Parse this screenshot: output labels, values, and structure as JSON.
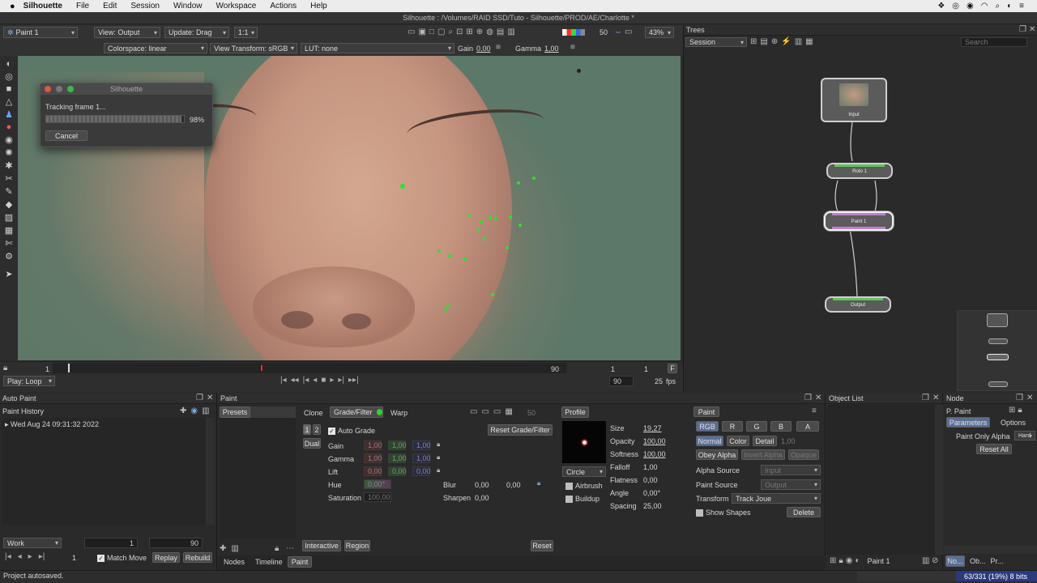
{
  "menubar": {
    "app": "Silhouette",
    "items": [
      "File",
      "Edit",
      "Session",
      "Window",
      "Workspace",
      "Actions",
      "Help"
    ],
    "clock_tray": "",
    "window_title": "Silhouette : /Volumes/RAID SSD/Tuto - Silhouette/PROD/AE/Charlotte *"
  },
  "viewer_toolbar": {
    "node_select": "Paint 1",
    "view": "View: Output",
    "update": "Update: Drag",
    "ratio": "1:1",
    "frame_count": "50",
    "zoom": "43%",
    "colorspace": "Colorspace: linear",
    "view_transform": "View Transform: sRGB",
    "lut": "LUT: none",
    "gain_label": "Gain",
    "gain_value": "0,00",
    "gamma_label": "Gamma",
    "gamma_value": "1,00"
  },
  "dialog": {
    "title": "Silhouette",
    "message": "Tracking frame 1...",
    "progress_text": "98%",
    "progress": 0.98,
    "cancel": "Cancel"
  },
  "timeline": {
    "start": "1",
    "end_marker": "90",
    "current": "1",
    "current2": "1",
    "flag": "F",
    "play_mode": "Play: Loop",
    "end_frame": "90",
    "fps_value": "25",
    "fps_label": "fps"
  },
  "trees": {
    "title": "Trees",
    "session": "Session",
    "search_placeholder": "Search",
    "nodes": {
      "input": "Input",
      "roto": "Roto 1",
      "paint": "Paint 1",
      "output": "Output"
    }
  },
  "autopaint": {
    "title": "Auto Paint",
    "history_title": "Paint History",
    "history_item": "Wed Aug 24 09:31:32 2022",
    "work_select": "Work",
    "range_start": "1",
    "range_end": "90",
    "frame": "1",
    "match_move": "Match Move",
    "replay": "Replay",
    "rebuild": "Rebuild",
    "status": "Project autosaved."
  },
  "paint": {
    "title": "Paint",
    "presets": "Presets",
    "tabs": [
      "Clone",
      "Grade/Filter",
      "Warp"
    ],
    "frame_field": "50",
    "profile": "Profile",
    "seg_1": "1",
    "seg_2": "2",
    "dual": "Dual",
    "auto_grade": "Auto Grade",
    "reset_grade": "Reset Grade/Filter",
    "gain_label": "Gain",
    "gamma_label": "Gamma",
    "lift_label": "Lift",
    "hue_label": "Hue",
    "saturation_label": "Saturation",
    "gain": [
      "1,00",
      "1,00",
      "1,00"
    ],
    "gamma": [
      "1,00",
      "1,00",
      "1,00"
    ],
    "lift": [
      "0,00",
      "0,00",
      "0,00"
    ],
    "hue": "0,00°",
    "saturation": "100,00",
    "blur_label": "Blur",
    "blur": [
      "0,00",
      "0,00"
    ],
    "sharpen_label": "Sharpen",
    "sharpen": "0,00",
    "brush_shape": "Circle",
    "airbrush": "Airbrush",
    "buildup": "Buildup",
    "size_label": "Size",
    "size": "19,27",
    "opacity_label": "Opacity",
    "opacity": "100,00",
    "softness_label": "Softness",
    "softness": "100,00",
    "falloff_label": "Falloff",
    "falloff": "1,00",
    "flatness_label": "Flatness",
    "flatness": "0,00",
    "angle_label": "Angle",
    "angle": "0,00°",
    "spacing_label": "Spacing",
    "spacing": "25,00",
    "interactive": "Interactive",
    "region": "Region",
    "reset": "Reset",
    "bottom_tabs": [
      "Nodes",
      "Timeline",
      "Paint"
    ]
  },
  "paint_right": {
    "title": "Paint",
    "channels": [
      "RGB",
      "R",
      "G",
      "B",
      "A"
    ],
    "modes": [
      "Normal",
      "Color",
      "Detail"
    ],
    "mode_value": "1,00",
    "obey_alpha": "Obey Alpha",
    "invert_alpha": "Invert Alpha",
    "opaque": "Opaque",
    "alpha_source_label": "Alpha Source",
    "alpha_source": "Input",
    "paint_source_label": "Paint Source",
    "paint_source": "Output",
    "transform_label": "Transform",
    "transform": "Track Joue",
    "show_shapes": "Show Shapes",
    "delete": "Delete"
  },
  "object_list": {
    "title": "Object List",
    "footer_item": "Paint 1"
  },
  "node_panel": {
    "title": "Node",
    "node_name": "P. Paint",
    "tabs": [
      "Parameters",
      "Options"
    ],
    "paint_only_alpha": "Paint Only Alpha",
    "hard": "Hard",
    "reset_all": "Reset All",
    "footer_tabs": [
      "No...",
      "Ob...",
      "Pr..."
    ]
  },
  "status_right": "63/331 (19%) 8 bits",
  "colors": {
    "accent_blue": "#4f7fbf",
    "track_green": "#2fe02f",
    "panel_bg": "#2b2b2b"
  }
}
